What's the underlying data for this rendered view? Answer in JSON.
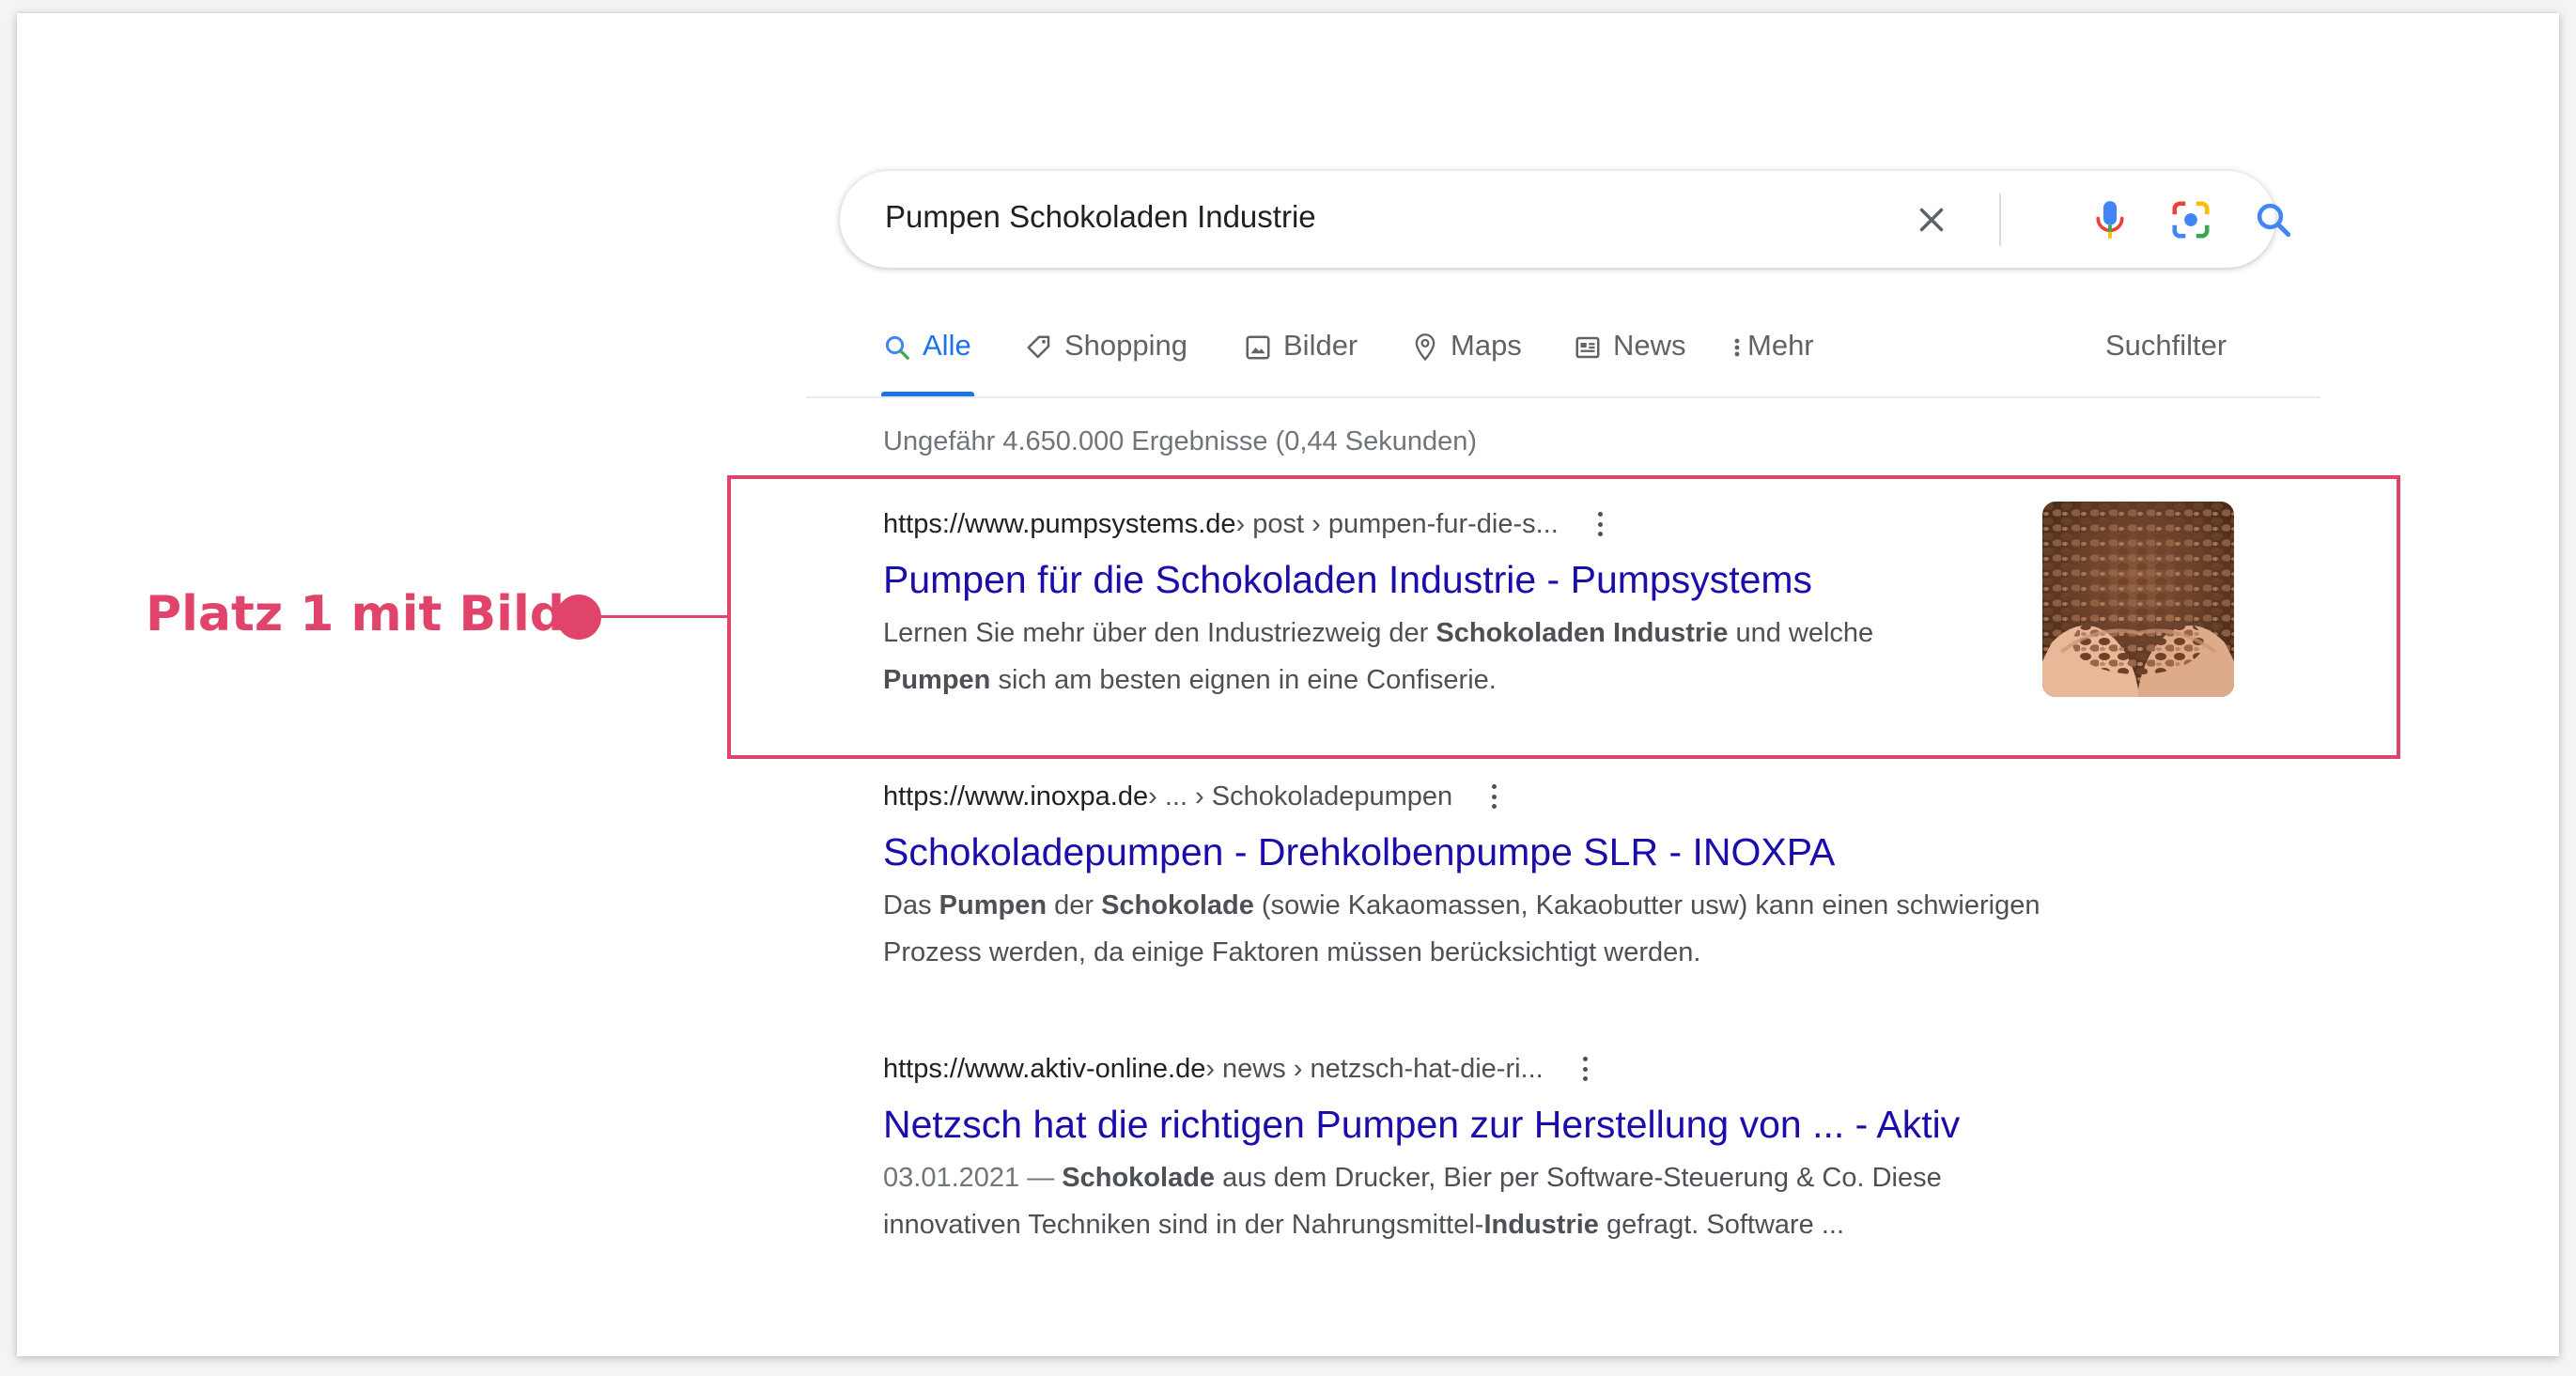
{
  "search": {
    "query": "Pumpen Schokoladen Industrie",
    "icons": [
      "close-icon",
      "microphone-icon",
      "camera-lens-icon",
      "search-icon"
    ]
  },
  "tabs": [
    {
      "label": "Alle",
      "icon": "search-icon",
      "active": true
    },
    {
      "label": "Shopping",
      "icon": "tag-icon"
    },
    {
      "label": "Bilder",
      "icon": "image-icon"
    },
    {
      "label": "Maps",
      "icon": "map-pin-icon"
    },
    {
      "label": "News",
      "icon": "newspaper-icon"
    },
    {
      "label": "Mehr",
      "icon": "more-vertical-icon"
    }
  ],
  "tools_label": "Suchfilter",
  "stats": "Ungefähr 4.650.000 Ergebnisse (0,44 Sekunden)",
  "results": [
    {
      "domain": "https://www.pumpsystems.de",
      "breadcrumb": " › post › pumpen-fur-die-s...",
      "title": "Pumpen für die Schokoladen Industrie - Pumpsystems",
      "snippet_parts": [
        {
          "t": "Lernen Sie mehr über den Industriezweig der ",
          "b": false
        },
        {
          "t": "Schokoladen Industrie",
          "b": true
        },
        {
          "t": " und welche",
          "b": false
        },
        {
          "t": "\n",
          "b": false
        },
        {
          "t": "Pumpen",
          "b": true
        },
        {
          "t": " sich am besten eignen in eine Confiserie.",
          "b": false
        }
      ],
      "thumbnail": "cocoa-beans-in-hands-image"
    },
    {
      "domain": "https://www.inoxpa.de",
      "breadcrumb": " › ... › Schokoladepumpen",
      "title": "Schokoladepumpen - Drehkolbenpumpe SLR - INOXPA",
      "snippet_parts": [
        {
          "t": "Das ",
          "b": false
        },
        {
          "t": "Pumpen",
          "b": true
        },
        {
          "t": " der ",
          "b": false
        },
        {
          "t": "Schokolade",
          "b": true
        },
        {
          "t": " (sowie Kakaomassen, Kakaobutter usw) kann einen schwierigen",
          "b": false
        },
        {
          "t": "\n",
          "b": false
        },
        {
          "t": "Prozess werden, da einige Faktoren müssen berücksichtigt werden.",
          "b": false
        }
      ]
    },
    {
      "domain": "https://www.aktiv-online.de",
      "breadcrumb": " › news › netzsch-hat-die-ri...",
      "title": "Netzsch hat die richtigen Pumpen zur Herstellung von ... - Aktiv",
      "date": "03.01.2021 — ",
      "snippet_parts": [
        {
          "t": "Schokolade",
          "b": true
        },
        {
          "t": " aus dem Drucker, Bier per Software-Steuerung & Co. Diese",
          "b": false
        },
        {
          "t": "\n",
          "b": false
        },
        {
          "t": "innovativen Techniken sind in der Nahrungsmittel-",
          "b": false
        },
        {
          "t": "Industrie",
          "b": true
        },
        {
          "t": " gefragt. Software ...",
          "b": false
        }
      ]
    }
  ],
  "annotation": {
    "label": "Platz 1 mit Bild",
    "color": "#e0446a"
  },
  "colors": {
    "link": "#1a0dab",
    "accent": "#1a73e8",
    "text": "#202124",
    "muted": "#70757a"
  }
}
